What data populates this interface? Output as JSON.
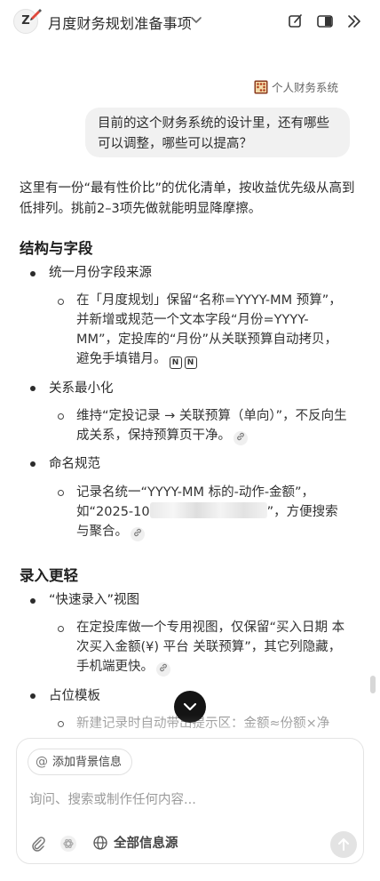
{
  "header": {
    "avatar_letter": "Z",
    "title": "月度财务规划准备事项"
  },
  "conversation": {
    "context_tag": "个人财务系统",
    "user_message": "目前的这个财务系统的设计里，还有哪些可以调整，哪些可以提高？",
    "intro": "这里有一份“最有性价比”的优化清单，按收益优先级从高到低排列。挑前2–3项先做就能明显降摩擦。",
    "sections": [
      {
        "heading": "结构与字段",
        "items": [
          {
            "title": "统一月份字段来源",
            "detail": "在「月度规划」保留“名称=YYYY-MM 预算”，并新增或规范一个文本字段“月份=YYYY-MM”，定投库的“月份”从关联预算自动拷贝，避免手填错月。"
          },
          {
            "title": "关系最小化",
            "detail": "维持“定投记录 → 关联预算（单向）”，不反向生成关系，保持预算页干净。"
          },
          {
            "title": "命名规范",
            "detail_prefix": "记录名统一“YYYY-MM 标的-动作-金额”，如“2025-10",
            "detail_suffix": "”，方便搜索与聚合。"
          }
        ]
      },
      {
        "heading": "录入更轻",
        "items": [
          {
            "title": "“快速录入”视图",
            "detail": "在定投库做一个专用视图，仅保留“买入日期 本次买入金额(¥) 平台 关联预算”，其它列隐藏，手机端更快。"
          },
          {
            "title": "占位模板",
            "detail": "新建记录时自动带出提示区：金额≈份额×净"
          }
        ]
      }
    ]
  },
  "composer": {
    "context_button": "添加背景信息",
    "placeholder": "询问、搜索或制作任何内容...",
    "sources_label": "全部信息源"
  }
}
